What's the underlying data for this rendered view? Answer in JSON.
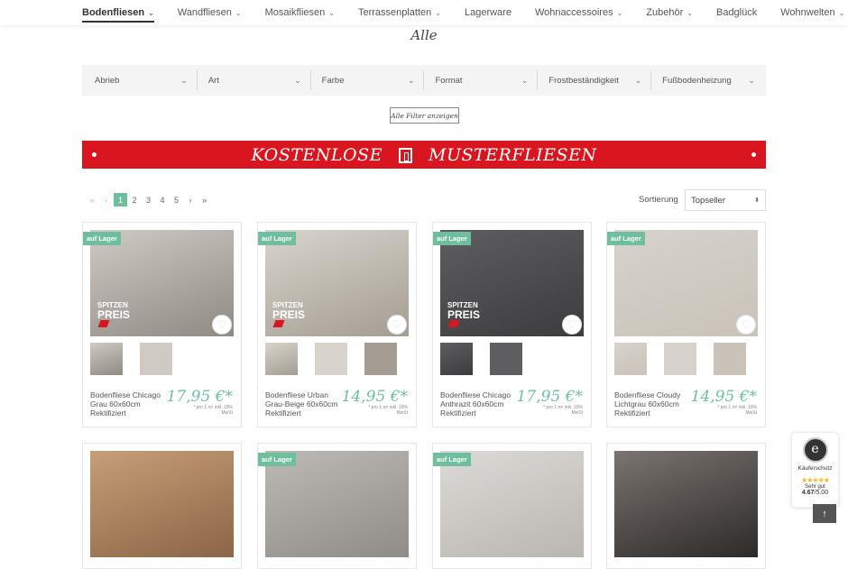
{
  "nav": {
    "items": [
      {
        "label": "Bodenfliesen",
        "chevron": true,
        "active": true
      },
      {
        "label": "Wandfliesen",
        "chevron": true
      },
      {
        "label": "Mosaikfliesen",
        "chevron": true
      },
      {
        "label": "Terrassenplatten",
        "chevron": true
      },
      {
        "label": "Lagerware",
        "chevron": false
      },
      {
        "label": "Wohnaccessoires",
        "chevron": true
      },
      {
        "label": "Zubehör",
        "chevron": true
      },
      {
        "label": "Badglück",
        "chevron": false
      },
      {
        "label": "Wohnwelten",
        "chevron": true
      }
    ]
  },
  "page": {
    "heading": "Alle"
  },
  "filters": {
    "items": [
      "Abrieb",
      "Art",
      "Farbe",
      "Format",
      "Frostbeständigkeit",
      "Fußbodenheizung"
    ],
    "all_filters_label": "Alle Filter anzeigen"
  },
  "banner": {
    "left_text": "KOSTENLOSE",
    "right_text": "MUSTERFLIESEN"
  },
  "pagination": {
    "first": "«",
    "prev": "‹",
    "pages": [
      "1",
      "2",
      "3",
      "4",
      "5"
    ],
    "active_page": "1",
    "next": "›",
    "last": "»"
  },
  "sort": {
    "label": "Sortierung",
    "selected": "Topseller"
  },
  "product_badge": "auf Lager",
  "spitzen_label": {
    "line1": "SPITZEN",
    "line2": "PREIS"
  },
  "products": [
    {
      "name": "Bodenfliese Chicago Grau 60x60cm Rektifiziert",
      "price": "17,95 €*",
      "note": "* pro 1 m² inkl. 19% MwSt",
      "badge": true,
      "spitzen": true,
      "thumbs": 2,
      "colors": [
        "#cfcac2",
        "#8e8a84"
      ]
    },
    {
      "name": "Bodenfliese Urban Grau-Beige 60x60cm Rektifiziert",
      "price": "14,95 €*",
      "note": "* pro 1 m² inkl. 19% MwSt",
      "badge": true,
      "spitzen": true,
      "thumbs": 3,
      "colors": [
        "#d9d4cb",
        "#a39d94"
      ]
    },
    {
      "name": "Bodenfliese Chicago Anthrazit 60x60cm Rektifiziert",
      "price": "17,95 €*",
      "note": "* pro 1 m² inkl. 19% MwSt",
      "badge": true,
      "spitzen": true,
      "thumbs": 2,
      "colors": [
        "#5e5e60",
        "#3c3c3e"
      ]
    },
    {
      "name": "Bodenfliese Cloudy Lichtgrau 60x60cm Rektifiziert",
      "price": "14,95 €*",
      "note": "* pro 1 m² inkl. 19% MwSt",
      "badge": true,
      "spitzen": false,
      "thumbs": 3,
      "colors": [
        "#d7d2ca",
        "#c9c3ba"
      ]
    },
    {
      "name": "",
      "price": "",
      "note": "",
      "badge": false,
      "spitzen": false,
      "thumbs": 0,
      "colors": [
        "#c69f78",
        "#8b6546"
      ]
    },
    {
      "name": "",
      "price": "",
      "note": "",
      "badge": true,
      "spitzen": false,
      "thumbs": 0,
      "colors": [
        "#bdbab6",
        "#8f8c88"
      ]
    },
    {
      "name": "",
      "price": "",
      "note": "",
      "badge": true,
      "spitzen": false,
      "thumbs": 0,
      "colors": [
        "#dcdad6",
        "#b9b6b1"
      ]
    },
    {
      "name": "",
      "price": "",
      "note": "",
      "badge": false,
      "spitzen": false,
      "thumbs": 0,
      "colors": [
        "#7b7470",
        "#2d2a28"
      ]
    }
  ],
  "trust": {
    "label": "Käuferschutz",
    "stars": "★★★★★",
    "rating_text": "Sehr gut",
    "score": "4.67",
    "max": "/5.00"
  },
  "totop_icon": "arrow-up-icon",
  "colors": {
    "accent": "#6fbf9e",
    "banner": "#d9161f"
  }
}
